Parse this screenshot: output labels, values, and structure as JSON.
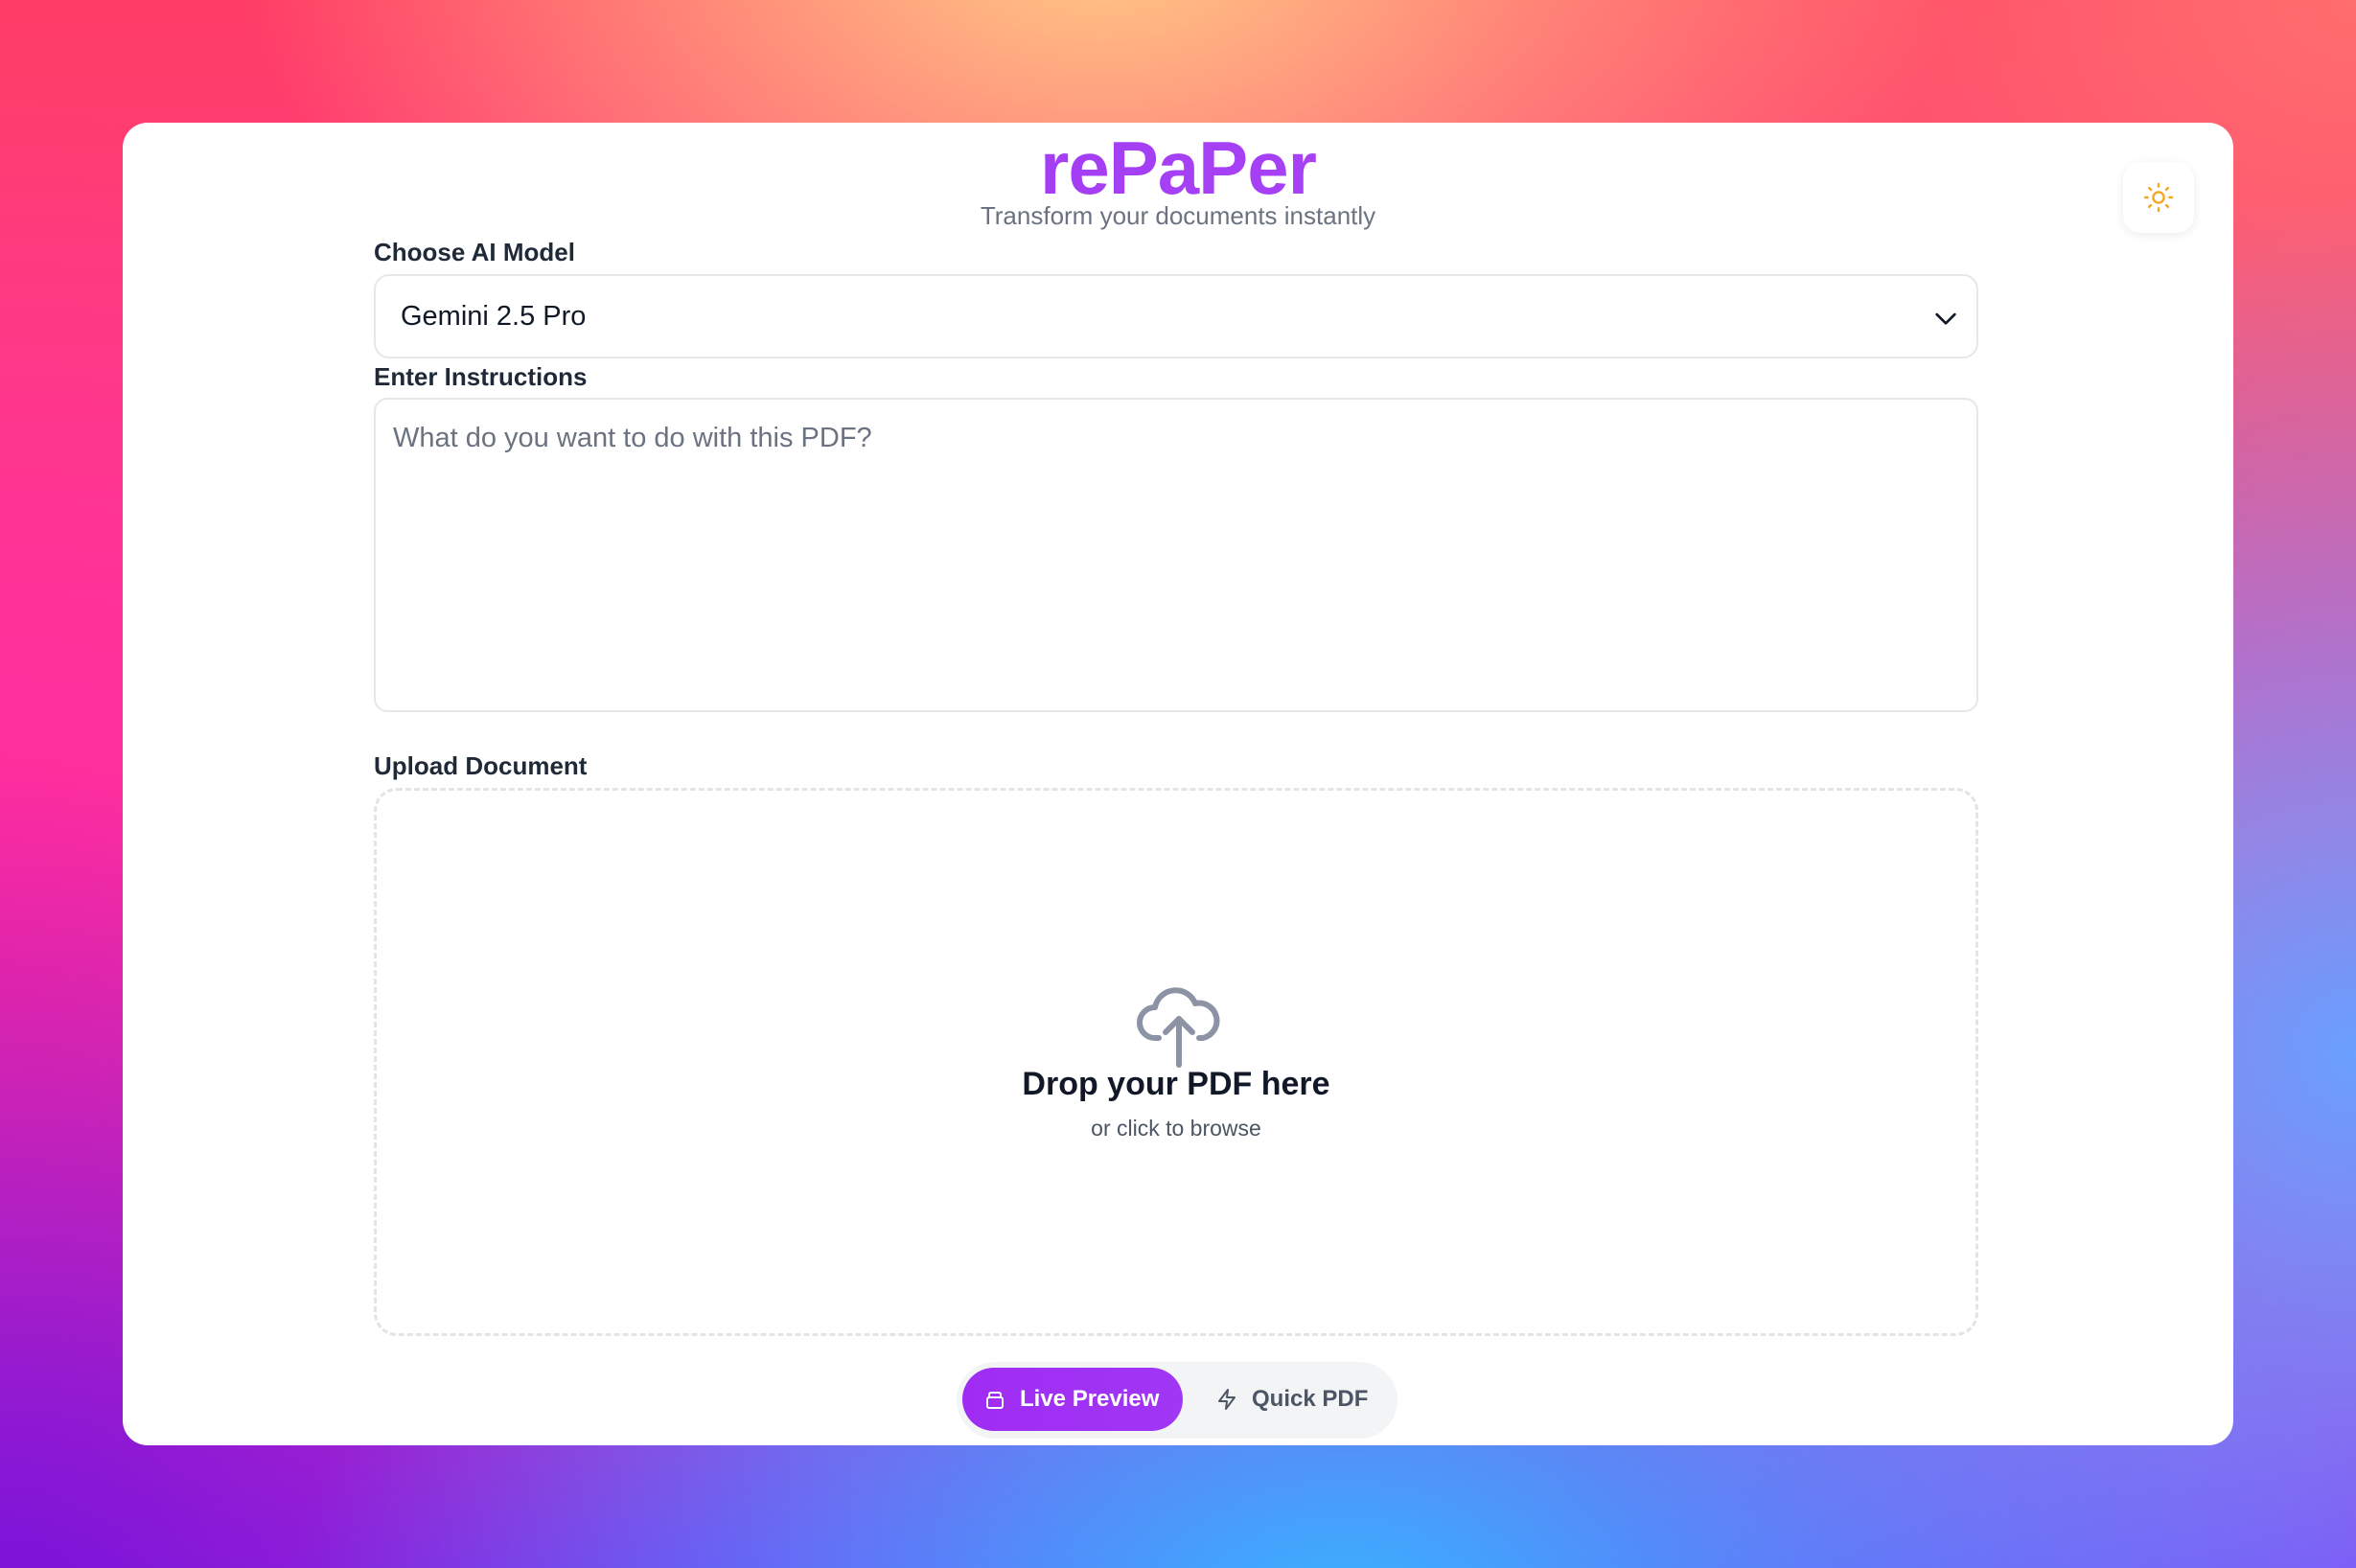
{
  "app": {
    "title": "rePaPer",
    "tagline": "Transform your documents instantly"
  },
  "theme_toggle": {
    "icon": "sun-icon",
    "icon_color": "#f5a623"
  },
  "model": {
    "label": "Choose AI Model",
    "selected": "Gemini 2.5 Pro"
  },
  "instructions": {
    "label": "Enter Instructions",
    "placeholder": "What do you want to do with this PDF?",
    "value": ""
  },
  "upload": {
    "label": "Upload Document",
    "title": "Drop your PDF here",
    "subtitle": "or click to browse",
    "icon": "cloud-upload-icon"
  },
  "modes": {
    "live_preview_label": "Live Preview",
    "quick_pdf_label": "Quick PDF",
    "active": "Live Preview"
  },
  "colors": {
    "brand": "#a23ef4",
    "accent_button": "#a02cf3"
  }
}
